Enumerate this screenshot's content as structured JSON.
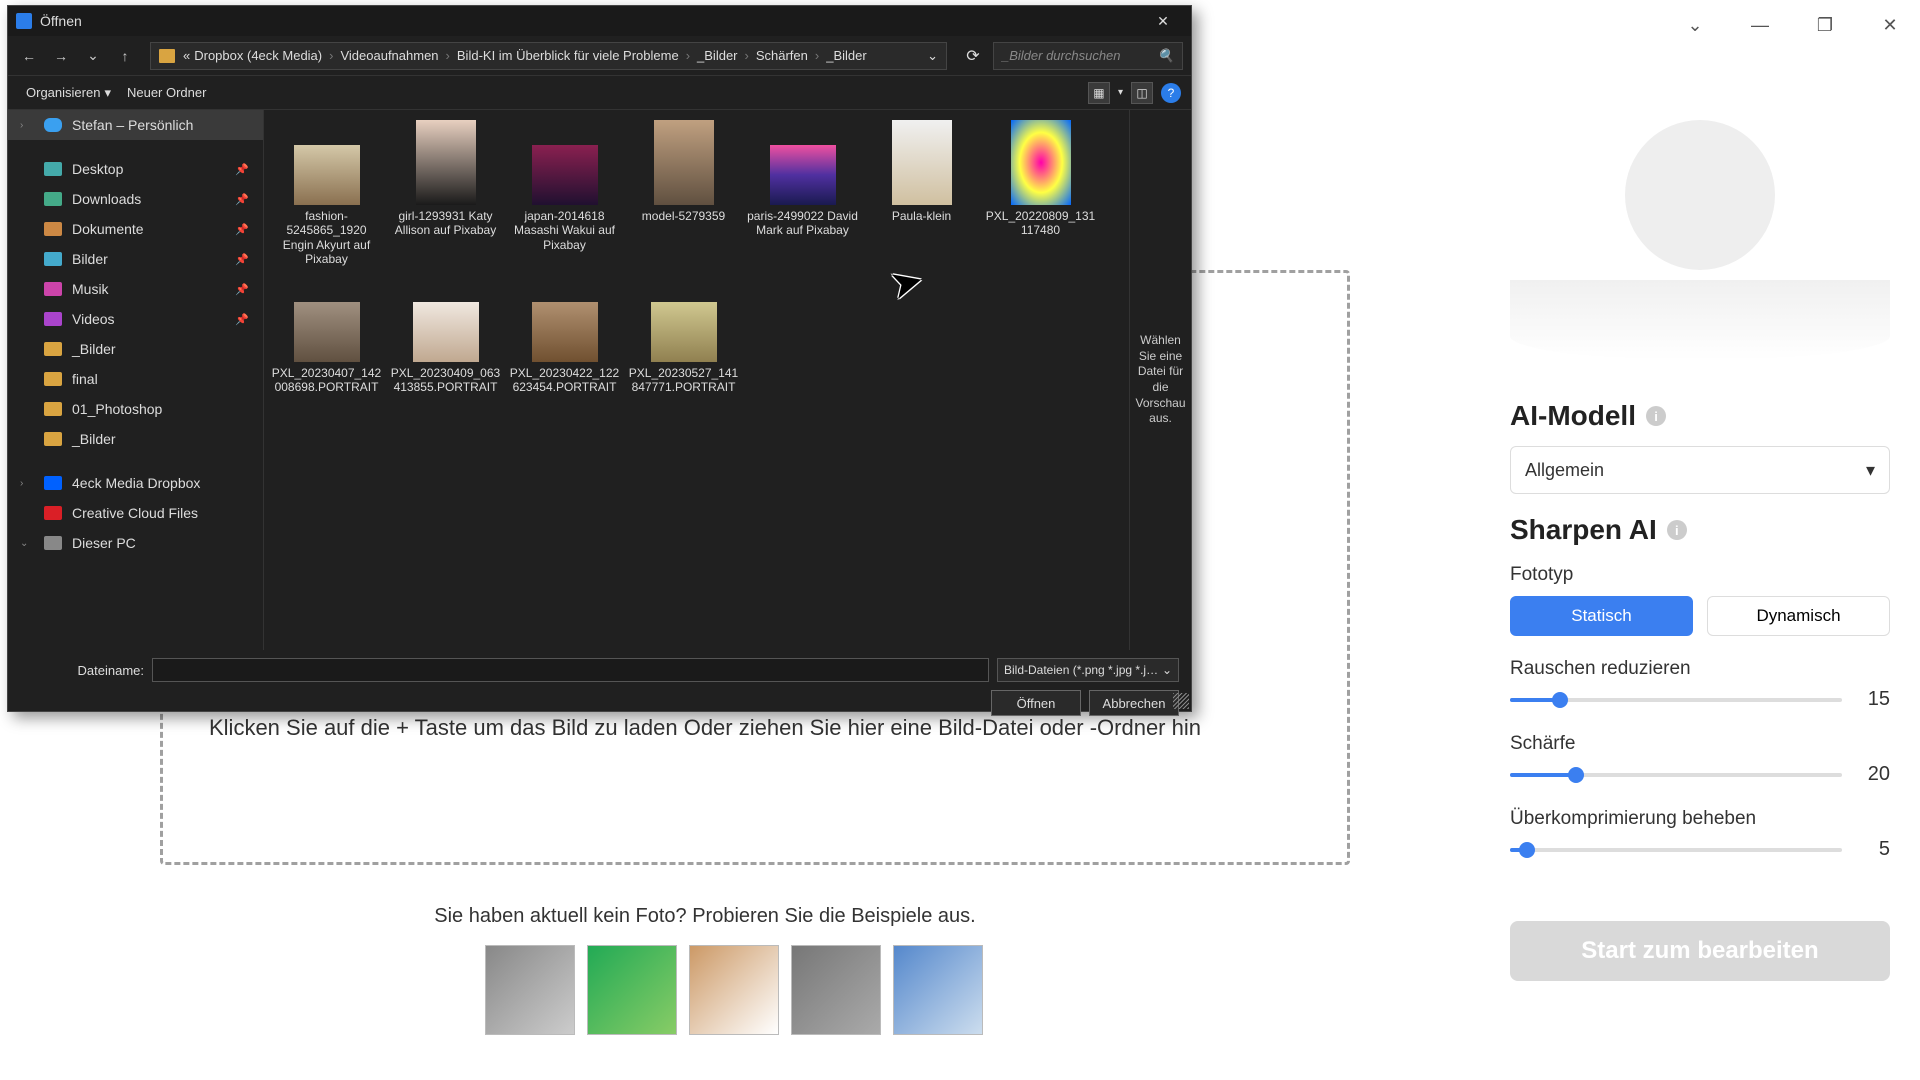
{
  "app": {
    "titlebar": {
      "collapse": "⌄",
      "min": "—",
      "max": "❐",
      "close": "✕"
    }
  },
  "dropzone": {
    "text": "Klicken Sie auf die + Taste um das Bild zu laden Oder ziehen Sie hier eine Bild-Datei oder -Ordner hin",
    "examples_text": "Sie haben aktuell kein Foto? Probieren Sie die Beispiele aus."
  },
  "panel": {
    "ai_model_title": "AI-Modell",
    "ai_model_value": "Allgemein",
    "sharpen_title": "Sharpen AI",
    "phototype_label": "Fototyp",
    "static": "Statisch",
    "dynamic": "Dynamisch",
    "noise_label": "Rauschen reduzieren",
    "noise_value": "15",
    "sharp_label": "Schärfe",
    "sharp_value": "20",
    "overcomp_label": "Überkomprimierung beheben",
    "overcomp_value": "5",
    "start_btn": "Start zum bearbeiten"
  },
  "dialog": {
    "title": "Öffnen",
    "breadcrumb": [
      "«",
      "Dropbox (4eck Media)",
      "Videoaufnahmen",
      "Bild-KI im Überblick für viele Probleme",
      "_Bilder",
      "Schärfen",
      "_Bilder"
    ],
    "search_placeholder": "_Bilder durchsuchen",
    "organize": "Organisieren",
    "new_folder": "Neuer Ordner",
    "sidebar": {
      "personal": "Stefan – Persönlich",
      "desktop": "Desktop",
      "downloads": "Downloads",
      "dokumente": "Dokumente",
      "bilder": "Bilder",
      "musik": "Musik",
      "videos": "Videos",
      "bilder2": "_Bilder",
      "final": "final",
      "photoshop": "01_Photoshop",
      "bilder3": "_Bilder",
      "dropbox": "4eck Media Dropbox",
      "cc": "Creative Cloud Files",
      "pc": "Dieser PC"
    },
    "files": [
      {
        "name": "fashion-5245865_1920 Engin Akyurt auf Pixabay"
      },
      {
        "name": "girl-1293931 Katy Allison auf Pixabay"
      },
      {
        "name": "japan-2014618 Masashi Wakui auf Pixabay"
      },
      {
        "name": "model-5279359"
      },
      {
        "name": "paris-2499022 David Mark auf Pixabay"
      },
      {
        "name": "Paula-klein"
      },
      {
        "name": "PXL_20220809_131117480"
      },
      {
        "name": "PXL_20230407_142008698.PORTRAIT"
      },
      {
        "name": "PXL_20230409_063413855.PORTRAIT"
      },
      {
        "name": "PXL_20230422_122623454.PORTRAIT"
      },
      {
        "name": "PXL_20230527_141847771.PORTRAIT"
      }
    ],
    "preview_hint": "Wählen Sie eine Datei für die Vorschau aus.",
    "filename_label": "Dateiname:",
    "filter": "Bild-Dateien (*.png *.jpg *.jpeg)",
    "open_btn": "Öffnen",
    "cancel_btn": "Abbrechen"
  }
}
